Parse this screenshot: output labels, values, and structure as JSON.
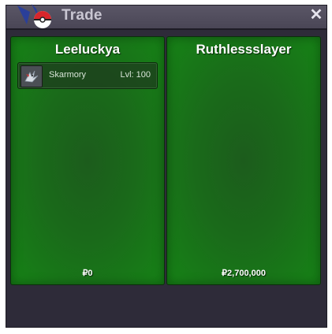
{
  "window": {
    "title": "Trade",
    "close_glyph": "✕"
  },
  "trade": {
    "left": {
      "player": "Leeluckya",
      "pokemon": [
        {
          "name": "Skarmory",
          "level": "Lvl: 100",
          "icon": "skarmory-sprite-icon"
        }
      ],
      "money": "₽0"
    },
    "right": {
      "player": "Ruthlessslayer",
      "pokemon": [],
      "money": "₽2,700,000"
    }
  },
  "colors": {
    "panel_green": "#1a6a1a",
    "titlebar": "#4a4656",
    "window_bg": "#2e2b39"
  }
}
